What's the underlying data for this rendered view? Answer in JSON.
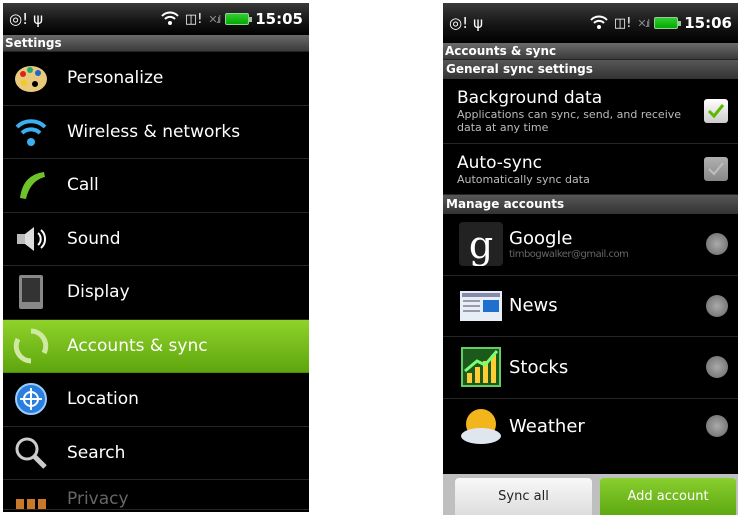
{
  "left": {
    "status": {
      "time": "15:05"
    },
    "title": "Settings",
    "items": [
      {
        "label": "Personalize",
        "icon": "palette-icon"
      },
      {
        "label": "Wireless & networks",
        "icon": "wifi-icon"
      },
      {
        "label": "Call",
        "icon": "phone-handset-icon"
      },
      {
        "label": "Sound",
        "icon": "speaker-icon"
      },
      {
        "label": "Display",
        "icon": "display-icon"
      },
      {
        "label": "Accounts & sync",
        "icon": "sync-icon",
        "active": true
      },
      {
        "label": "Location",
        "icon": "location-globe-icon"
      },
      {
        "label": "Search",
        "icon": "magnifier-icon"
      },
      {
        "label": "Privacy",
        "icon": "privacy-icon"
      }
    ]
  },
  "right": {
    "status": {
      "time": "15:06"
    },
    "title": "Accounts & sync",
    "general_header": "General sync settings",
    "background_data": {
      "title": "Background data",
      "desc": "Applications can sync, send, and receive data at any time",
      "checked": true
    },
    "auto_sync": {
      "title": "Auto-sync",
      "desc": "Automatically sync data",
      "checked": false
    },
    "manage_header": "Manage accounts",
    "accounts": [
      {
        "name": "Google",
        "sub": "timbogwalker@gmail.com",
        "icon": "google-icon"
      },
      {
        "name": "News",
        "sub": "",
        "icon": "news-icon"
      },
      {
        "name": "Stocks",
        "sub": "",
        "icon": "stocks-icon"
      },
      {
        "name": "Weather",
        "sub": "",
        "icon": "weather-icon"
      }
    ],
    "sync_all_label": "Sync all",
    "add_account_label": "Add account"
  },
  "colors": {
    "accent_green": "#76c01a",
    "background": "#000000"
  }
}
